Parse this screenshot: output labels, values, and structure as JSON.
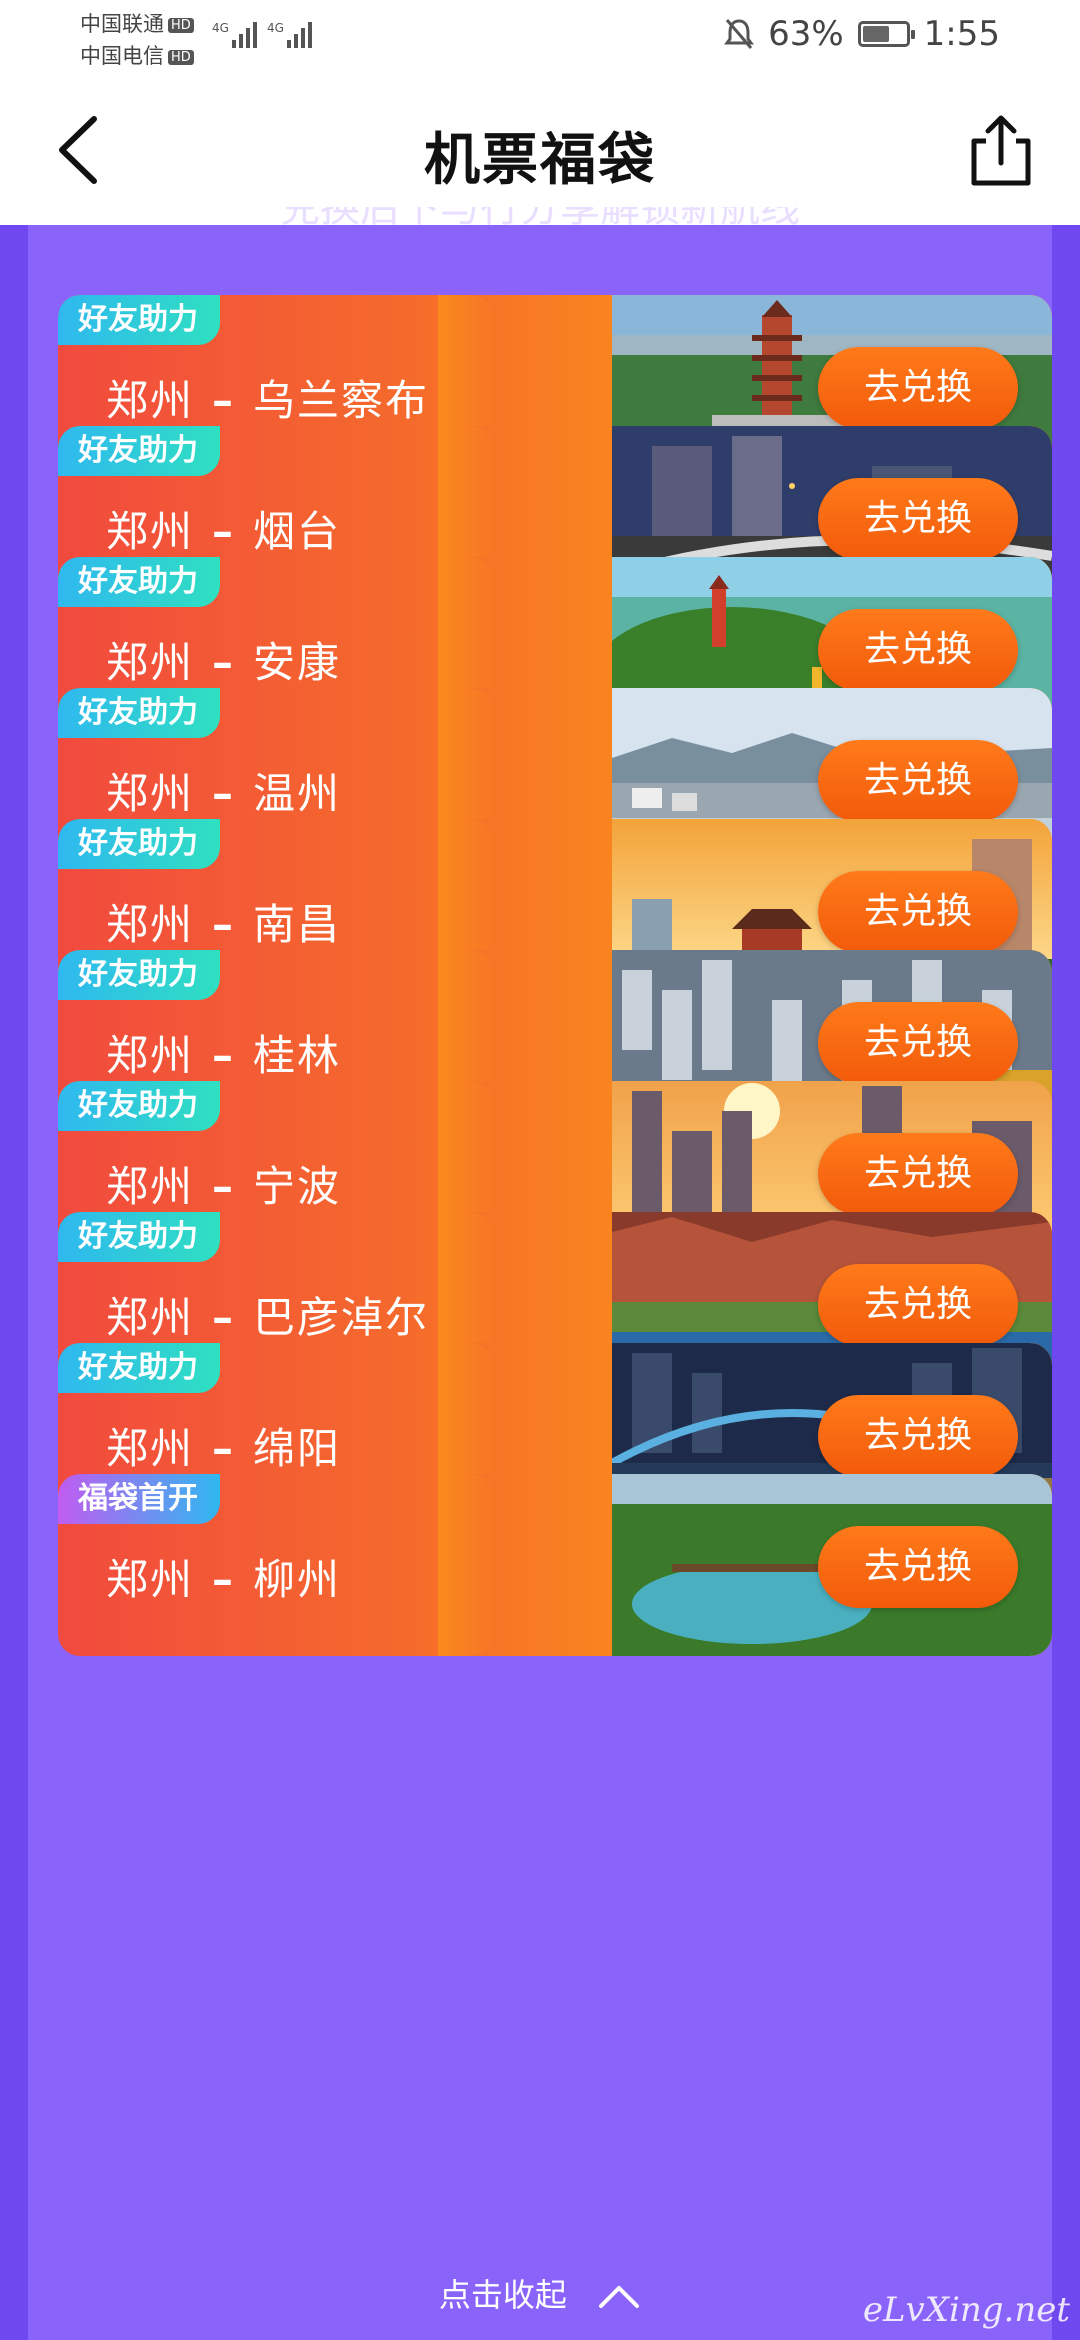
{
  "status_bar": {
    "carrier1": "中国联通",
    "carrier2": "中国电信",
    "hd": "HD",
    "net1": "4G",
    "net2": "4G",
    "battery_percent": "63%",
    "battery_level": 0.63,
    "time": "1:55"
  },
  "header": {
    "title": "机票福袋",
    "back_icon": "chevron-left-icon",
    "share_icon": "share-icon"
  },
  "panel": {
    "partial_text": "兑换后下与行分享解锁新航线",
    "collapse_label": "点击收起",
    "collapse_icon": "chevron-up-icon"
  },
  "routes": [
    {
      "badge": "好友助力",
      "from": "郑州",
      "dash": "–",
      "to": "乌兰察布",
      "button": "去兑换",
      "scene": "pagoda"
    },
    {
      "badge": "好友助力",
      "from": "郑州",
      "dash": "–",
      "to": "烟台",
      "button": "去兑换",
      "scene": "city-night"
    },
    {
      "badge": "好友助力",
      "from": "郑州",
      "dash": "–",
      "to": "安康",
      "button": "去兑换",
      "scene": "river-pagoda"
    },
    {
      "badge": "好友助力",
      "from": "郑州",
      "dash": "–",
      "to": "温州",
      "button": "去兑换",
      "scene": "river-city"
    },
    {
      "badge": "好友助力",
      "from": "郑州",
      "dash": "–",
      "to": "南昌",
      "button": "去兑换",
      "scene": "sunset-pavilion"
    },
    {
      "badge": "好友助力",
      "from": "郑州",
      "dash": "–",
      "to": "桂林",
      "button": "去兑换",
      "scene": "rocks"
    },
    {
      "badge": "好友助力",
      "from": "郑州",
      "dash": "–",
      "to": "宁波",
      "button": "去兑换",
      "scene": "sunset-skyline"
    },
    {
      "badge": "好友助力",
      "from": "郑州",
      "dash": "–",
      "to": "巴彦淖尔",
      "button": "去兑换",
      "scene": "red-mountain-lake"
    },
    {
      "badge": "好友助力",
      "from": "郑州",
      "dash": "–",
      "to": "绵阳",
      "button": "去兑换",
      "scene": "bridge-night"
    },
    {
      "badge": "福袋首开",
      "from": "郑州",
      "dash": "–",
      "to": "柳州",
      "button": "去兑换",
      "scene": "green-lake"
    }
  ],
  "watermark": "eLvXing.net",
  "colors": {
    "background": "#6f48f0",
    "panel": "#8a63fb",
    "card_left": "#f14a3e",
    "card_right": "#fa8a1c",
    "badge": "#2fb8f0",
    "button": "#f25a0a"
  }
}
